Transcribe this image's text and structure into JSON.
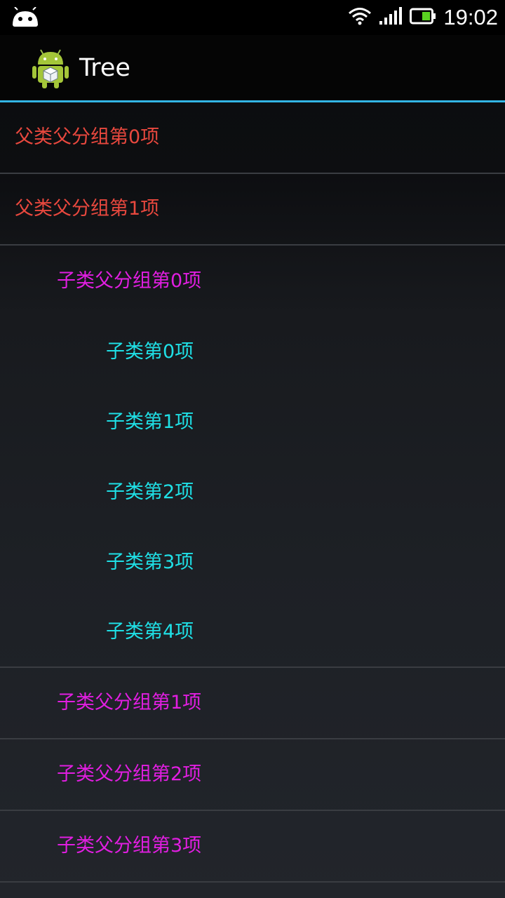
{
  "status_bar": {
    "time": "19:02",
    "icons": [
      "android-notification-icon",
      "wifi-icon",
      "signal-icon",
      "battery-icon"
    ]
  },
  "action_bar": {
    "title": "Tree",
    "icon": "android-robot-icon"
  },
  "tree": {
    "parent_0": "父类父分组第0项",
    "parent_1": "父类父分组第1项",
    "child_group_0": "子类父分组第0项",
    "child_items": [
      "子类第0项",
      "子类第1项",
      "子类第2项",
      "子类第3项",
      "子类第4项"
    ],
    "child_group_1": "子类父分组第1项",
    "child_group_2": "子类父分组第2项",
    "child_group_3": "子类父分组第3项"
  },
  "colors": {
    "accent": "#33b5e5",
    "parent_text": "#e8483e",
    "child_group_text": "#e11ee1",
    "child_item_text": "#1fe0e6"
  }
}
